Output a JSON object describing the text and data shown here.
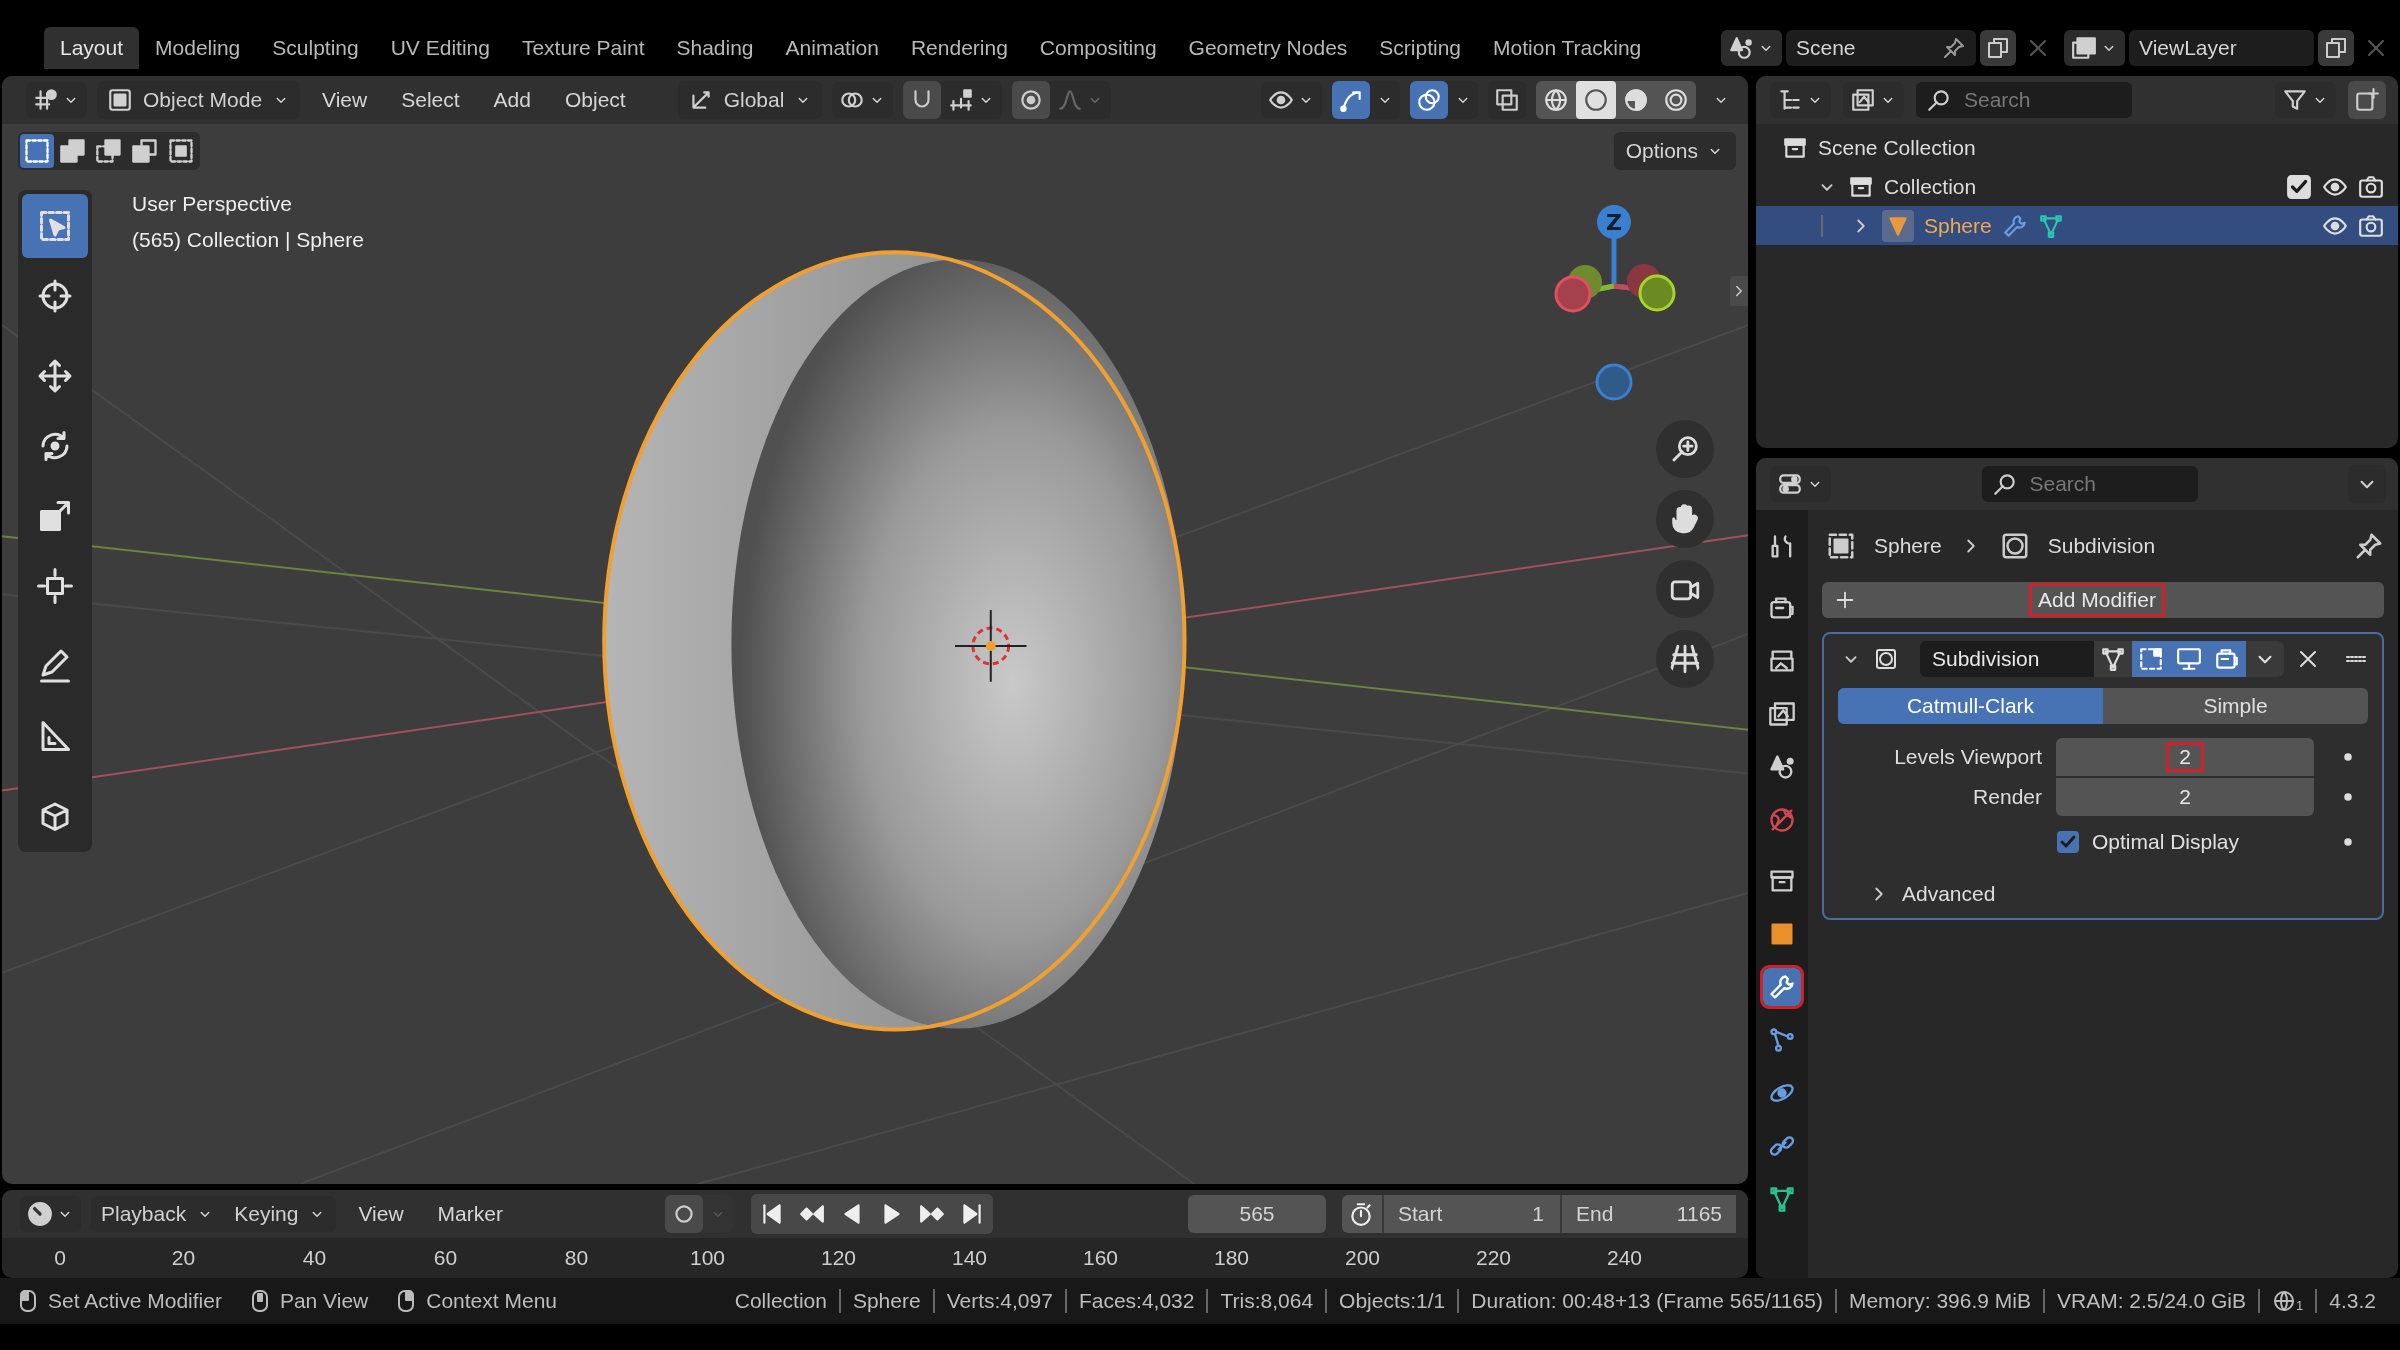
{
  "workspace_tabs": [
    {
      "label": "Layout",
      "selected": true
    },
    {
      "label": "Modeling",
      "selected": false
    },
    {
      "label": "Sculpting",
      "selected": false
    },
    {
      "label": "UV Editing",
      "selected": false
    },
    {
      "label": "Texture Paint",
      "selected": false
    },
    {
      "label": "Shading",
      "selected": false
    },
    {
      "label": "Animation",
      "selected": false
    },
    {
      "label": "Rendering",
      "selected": false
    },
    {
      "label": "Compositing",
      "selected": false
    },
    {
      "label": "Geometry Nodes",
      "selected": false
    },
    {
      "label": "Scripting",
      "selected": false
    },
    {
      "label": "Motion Tracking",
      "selected": false
    }
  ],
  "scene": {
    "name": "Scene"
  },
  "view_layer": {
    "name": "ViewLayer"
  },
  "viewport": {
    "header": {
      "mode": "Object Mode",
      "menus": [
        "View",
        "Select",
        "Add",
        "Object"
      ],
      "orientation": "Global",
      "toggles": [
        {
          "kind": "gizmos",
          "on": true
        },
        {
          "kind": "overlays",
          "on": true
        },
        {
          "kind": "xray",
          "on": false
        }
      ],
      "shading": [
        {
          "kind": "wireframe",
          "selected": false
        },
        {
          "kind": "solid",
          "selected": true
        },
        {
          "kind": "material",
          "selected": false
        },
        {
          "kind": "rendered",
          "selected": false
        }
      ]
    },
    "select_modes": [
      {
        "kind": "new",
        "selected": true
      },
      {
        "kind": "extend",
        "selected": false
      },
      {
        "kind": "subtract",
        "selected": false
      },
      {
        "kind": "invert",
        "selected": false
      },
      {
        "kind": "intersect",
        "selected": false
      }
    ],
    "options": "Options",
    "info": [
      "User Perspective",
      "(565) Collection | Sphere"
    ],
    "tools": [
      {
        "kind": "select",
        "selected": true
      },
      {
        "kind": "cursor",
        "selected": false
      },
      {
        "kind": "move",
        "selected": false
      },
      {
        "kind": "rotate",
        "selected": false
      },
      {
        "kind": "scale",
        "selected": false
      },
      {
        "kind": "transform",
        "selected": false
      },
      {
        "kind": "annotate",
        "selected": false
      },
      {
        "kind": "measure",
        "selected": false
      },
      {
        "kind": "add-cube",
        "selected": false
      }
    ],
    "gizmo": {
      "z_label": "Z"
    }
  },
  "outliner": {
    "search": {
      "placeholder": "Search"
    },
    "tree": [
      {
        "label": "Scene Collection",
        "kind": "scene-collection",
        "selected": false,
        "children": [
          {
            "label": "Collection",
            "kind": "collection",
            "selected": false,
            "expanded": true,
            "checked": true,
            "children": [
              {
                "label": "Sphere",
                "kind": "object",
                "selected": true,
                "expanded": false
              }
            ]
          }
        ]
      }
    ]
  },
  "properties": {
    "search": {
      "placeholder": "Search"
    },
    "tabs": [
      {
        "kind": "tool",
        "selected": false
      },
      {
        "kind": "render",
        "selected": false
      },
      {
        "kind": "output",
        "selected": false
      },
      {
        "kind": "view-layer",
        "selected": false
      },
      {
        "kind": "scene",
        "selected": false
      },
      {
        "kind": "world",
        "selected": false
      },
      {
        "kind": "collection",
        "selected": false
      },
      {
        "kind": "object",
        "selected": false
      },
      {
        "kind": "modifiers",
        "selected": true
      },
      {
        "kind": "particles",
        "selected": false
      },
      {
        "kind": "physics",
        "selected": false
      },
      {
        "kind": "constraints",
        "selected": false
      },
      {
        "kind": "data",
        "selected": false
      }
    ],
    "breadcrumb": [
      "Sphere",
      "Subdivision"
    ],
    "add_modifier": {
      "label": "Add Modifier",
      "highlighted": true
    },
    "modifier": {
      "name": "Subdivision",
      "expanded": true,
      "toggles": [
        {
          "kind": "edit-cage",
          "on": false
        },
        {
          "kind": "edit-mode",
          "on": true
        },
        {
          "kind": "viewport",
          "on": true
        },
        {
          "kind": "render",
          "on": true
        }
      ],
      "methods": [
        {
          "label": "Catmull-Clark",
          "selected": true
        },
        {
          "label": "Simple",
          "selected": false
        }
      ],
      "fields": [
        {
          "label": "Levels Viewport",
          "value": "2",
          "highlighted": true
        },
        {
          "label": "Render",
          "value": "2",
          "highlighted": false
        }
      ],
      "optimal_display": {
        "label": "Optimal Display",
        "checked": true
      },
      "advanced": {
        "label": "Advanced",
        "expanded": false
      }
    }
  },
  "timeline": {
    "menus": [
      "Playback",
      "Keying",
      "View",
      "Marker"
    ],
    "auto_keying": {
      "on": false
    },
    "current_frame": "565",
    "start": {
      "label": "Start",
      "value": "1"
    },
    "end": {
      "label": "End",
      "value": "1165"
    },
    "ruler": [
      "0",
      "20",
      "40",
      "60",
      "80",
      "100",
      "120",
      "140",
      "160",
      "180",
      "200",
      "220",
      "240"
    ]
  },
  "status_bar": {
    "hints": [
      {
        "kind": "left",
        "label": "Set Active Modifier"
      },
      {
        "kind": "middle",
        "label": "Pan View"
      },
      {
        "kind": "right",
        "label": "Context Menu"
      }
    ],
    "stats": [
      "Collection",
      "Sphere",
      "Verts:4,097",
      "Faces:4,032",
      "Tris:8,064",
      "Objects:1/1",
      "Duration: 00:48+13 (Frame 565/1165)",
      "Memory: 396.9 MiB",
      "VRAM: 2.5/24.0 GiB"
    ],
    "globe_badge": "1",
    "version": "4.3.2"
  }
}
